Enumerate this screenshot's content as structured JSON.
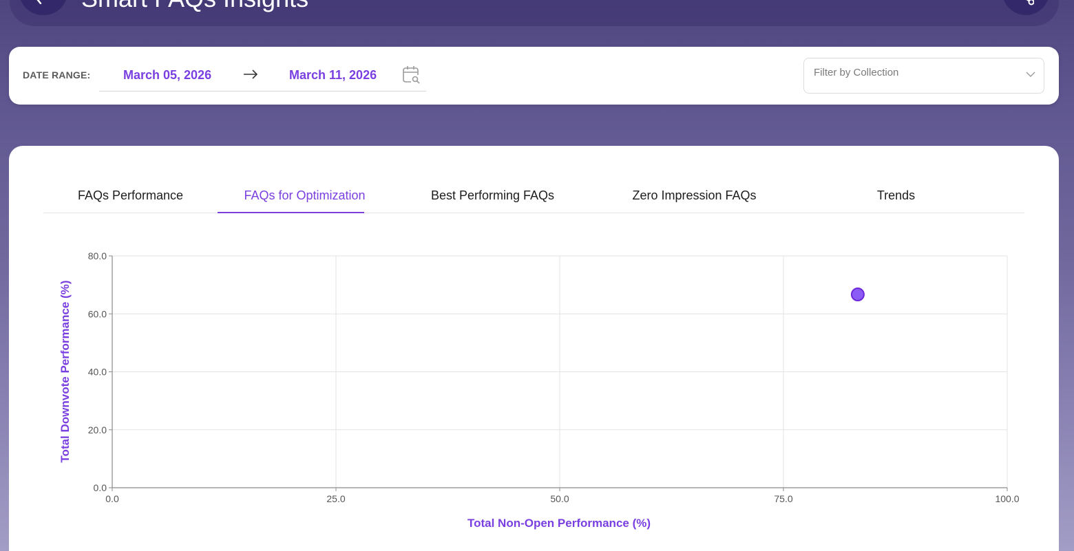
{
  "header": {
    "title": "Smart FAQs Insights"
  },
  "filters": {
    "date_label": "DATE RANGE:",
    "date_start": "March 05, 2026",
    "date_end": "March 11, 2026",
    "collection_placeholder": "Filter by Collection"
  },
  "tabs": [
    {
      "label": "FAQs Performance",
      "active": false
    },
    {
      "label": "FAQs for Optimization",
      "active": true
    },
    {
      "label": "Best Performing FAQs",
      "active": false
    },
    {
      "label": "Zero Impression FAQs",
      "active": false
    },
    {
      "label": "Trends",
      "active": false
    }
  ],
  "colors": {
    "accent": "#7a3fe0",
    "point_fill": "#8b5cf6",
    "point_stroke": "#6d28d9"
  },
  "chart_data": {
    "type": "scatter",
    "xlabel": "Total Non-Open Performance (%)",
    "ylabel": "Total Downvote Performance (%)",
    "xlim": [
      0,
      100
    ],
    "ylim": [
      0,
      80
    ],
    "xticks": [
      "0.0",
      "25.0",
      "50.0",
      "75.0",
      "100.0"
    ],
    "yticks": [
      "0.0",
      "20.0",
      "40.0",
      "60.0",
      "80.0"
    ],
    "xtick_values": [
      0,
      25,
      50,
      75,
      100
    ],
    "ytick_values": [
      0,
      20,
      40,
      60,
      80
    ],
    "grid": true,
    "points": [
      {
        "x": 83.3,
        "y": 66.7
      }
    ]
  }
}
